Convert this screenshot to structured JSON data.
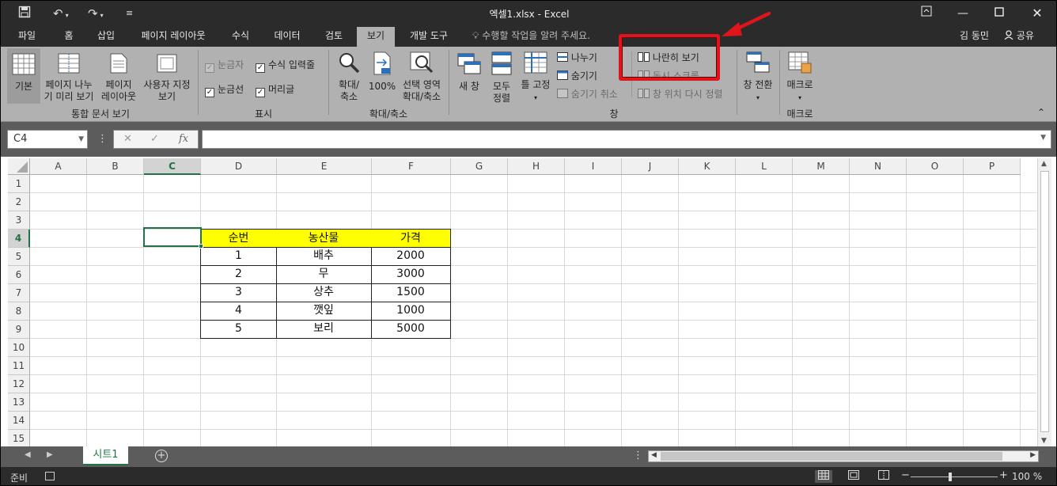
{
  "titlebar": {
    "title": "엑셀1.xlsx - Excel",
    "save_icon": "save-icon",
    "undo_icon": "undo-icon",
    "redo_icon": "redo-icon"
  },
  "tabs": {
    "items": [
      "파일",
      "홈",
      "삽입",
      "페이지 레이아웃",
      "수식",
      "데이터",
      "검토",
      "보기",
      "개발 도구"
    ],
    "active": "보기",
    "tell_me": "수행할 작업을 알려 주세요.",
    "user": "김 동민",
    "share": "공유"
  },
  "ribbon": {
    "workbook_views": {
      "label": "통합 문서 보기",
      "normal": "기본",
      "page_break_1": "페이지 나누",
      "page_break_2": "기 미리 보기",
      "page_layout_1": "페이지",
      "page_layout_2": "레이아웃",
      "custom_1": "사용자 지정",
      "custom_2": "보기"
    },
    "show": {
      "label": "표시",
      "ruler": "눈금자",
      "formula_bar": "수식 입력줄",
      "gridlines": "눈금선",
      "headings": "머리글"
    },
    "zoom": {
      "label": "확대/축소",
      "zoom_1": "확대/",
      "zoom_2": "축소",
      "hundred": "100%",
      "to_sel_1": "선택 영역",
      "to_sel_2": "확대/축소"
    },
    "window": {
      "label": "창",
      "new_window": "새 창",
      "arrange_1": "모두",
      "arrange_2": "정렬",
      "freeze": "틀 고정",
      "split": "나누기",
      "hide": "숨기기",
      "unhide": "숨기기 취소",
      "side_by_side": "나란히 보기",
      "sync_scroll": "동시 스크롤",
      "reset_pos": "창 위치 다시 정렬",
      "switch": "창 전환"
    },
    "macros": {
      "label": "매크로",
      "macro": "매크로"
    }
  },
  "formula_bar": {
    "name_box": "C4",
    "fx": "fx",
    "value": ""
  },
  "sheet": {
    "columns": [
      "A",
      "B",
      "C",
      "D",
      "E",
      "F",
      "G",
      "H",
      "I",
      "J",
      "K",
      "L",
      "M",
      "N",
      "O",
      "P"
    ],
    "rows": [
      "1",
      "2",
      "3",
      "4",
      "5",
      "6",
      "7",
      "8",
      "9",
      "10",
      "11",
      "12",
      "13",
      "14",
      "15"
    ],
    "selected_column": "C",
    "selected_row": "4",
    "table": {
      "headers": [
        "순번",
        "농산물",
        "가격"
      ],
      "rows": [
        [
          "1",
          "배추",
          "2000"
        ],
        [
          "2",
          "무",
          "3000"
        ],
        [
          "3",
          "상추",
          "1500"
        ],
        [
          "4",
          "깻잎",
          "1000"
        ],
        [
          "5",
          "보리",
          "5000"
        ]
      ],
      "header_color": "#ffff00"
    }
  },
  "sheet_tabs": {
    "active": "시트1"
  },
  "status": {
    "ready": "준비",
    "zoom": "100 %"
  },
  "colors": {
    "accent": "#217346",
    "annotation": "#e0141b"
  }
}
